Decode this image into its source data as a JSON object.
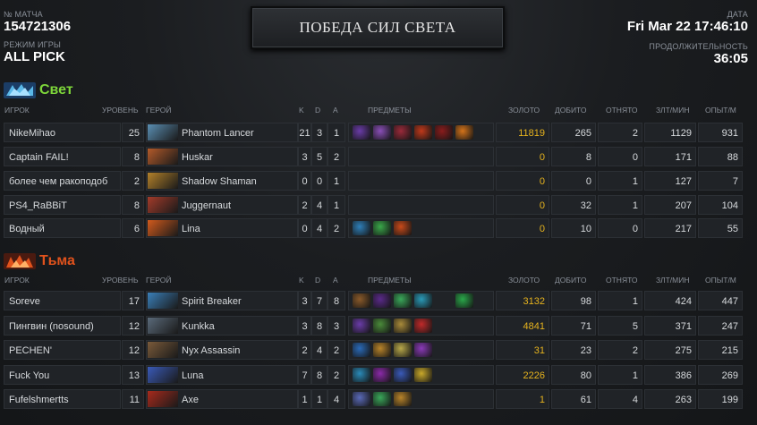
{
  "header": {
    "match_id_label": "№ МАТЧА",
    "match_id": "154721306",
    "game_mode_label": "РЕЖИМ ИГРЫ",
    "game_mode": "ALL PICK",
    "date_label": "ДАТА",
    "date": "Fri Mar 22 17:46:10",
    "duration_label": "ПРОДОЛЖИТЕЛЬНОСТЬ",
    "duration": "36:05",
    "result_banner": "ПОБЕДА СИЛ СВЕТА"
  },
  "columns": {
    "player": "ИГРОК",
    "level": "УРОВЕНЬ",
    "hero": "ГЕРОЙ",
    "k": "K",
    "d": "D",
    "a": "A",
    "items": "ПРЕДМЕТЫ",
    "gold": "ЗОЛОТО",
    "last_hits": "ДОБИТО",
    "denies": "ОТНЯТО",
    "xpm": "ЗЛТ/МИН",
    "gpm": "ОПЫТ/М"
  },
  "teams": [
    {
      "name": "Свет",
      "color": "#7dd63a",
      "icon": "radiant-icon",
      "players": [
        {
          "player": "NikeMihao",
          "level": "25",
          "hero": "Phantom Lancer",
          "hero_color": "#5a8fb3",
          "k": "21",
          "d": "3",
          "a": "1",
          "items": [
            "#6a3ca8",
            "#8a4fb8",
            "#9a2a3a",
            "#c0391b",
            "#8a1c1c",
            "#d4731a"
          ],
          "gold": "11819",
          "last_hits": "265",
          "denies": "2",
          "xpm": "1129",
          "gpm": "931"
        },
        {
          "player": "Captain FAIL!",
          "level": "8",
          "hero": "Huskar",
          "hero_color": "#b35a2a",
          "k": "3",
          "d": "5",
          "a": "2",
          "items": [],
          "gold": "0",
          "last_hits": "8",
          "denies": "0",
          "xpm": "171",
          "gpm": "88"
        },
        {
          "player": "более чем ракоподоб",
          "level": "2",
          "hero": "Shadow Shaman",
          "hero_color": "#b3812a",
          "k": "0",
          "d": "0",
          "a": "1",
          "items": [],
          "gold": "0",
          "last_hits": "0",
          "denies": "1",
          "xpm": "127",
          "gpm": "7"
        },
        {
          "player": "PS4_RaBBiT",
          "level": "8",
          "hero": "Juggernaut",
          "hero_color": "#a33b2a",
          "k": "2",
          "d": "4",
          "a": "1",
          "items": [],
          "gold": "0",
          "last_hits": "32",
          "denies": "1",
          "xpm": "207",
          "gpm": "104"
        },
        {
          "player": "Водный",
          "level": "6",
          "hero": "Lina",
          "hero_color": "#d25a1c",
          "k": "0",
          "d": "4",
          "a": "2",
          "items": [
            "#2f7fb8",
            "#3aa84a",
            "#c84a1a"
          ],
          "gold": "0",
          "last_hits": "10",
          "denies": "0",
          "xpm": "217",
          "gpm": "55"
        }
      ]
    },
    {
      "name": "Тьма",
      "color": "#e0521c",
      "icon": "dire-icon",
      "players": [
        {
          "player": "Soreve",
          "level": "17",
          "hero": "Spirit Breaker",
          "hero_color": "#3a7fb8",
          "k": "3",
          "d": "7",
          "a": "8",
          "items": [
            "#8a5a2a",
            "#5a2a8a",
            "#3aa85a",
            "#2a9ab8",
            "",
            "#2aa84a"
          ],
          "gold": "3132",
          "last_hits": "98",
          "denies": "1",
          "xpm": "424",
          "gpm": "447"
        },
        {
          "player": "Пингвин (nosound)",
          "level": "12",
          "hero": "Kunkka",
          "hero_color": "#5a6a7a",
          "k": "3",
          "d": "8",
          "a": "3",
          "items": [
            "#6a3ca8",
            "#4a8a3a",
            "#a88a3a",
            "#c02a2a"
          ],
          "gold": "4841",
          "last_hits": "71",
          "denies": "5",
          "xpm": "371",
          "gpm": "247"
        },
        {
          "player": "PECHEN'",
          "level": "12",
          "hero": "Nyx Assassin",
          "hero_color": "#7a5a3a",
          "k": "2",
          "d": "4",
          "a": "2",
          "items": [
            "#2a6ab8",
            "#b8842a",
            "#b8a84a",
            "#8a3ab8"
          ],
          "gold": "31",
          "last_hits": "23",
          "denies": "2",
          "xpm": "275",
          "gpm": "215"
        },
        {
          "player": "Fuck You",
          "level": "13",
          "hero": "Luna",
          "hero_color": "#3a5ab8",
          "k": "7",
          "d": "8",
          "a": "2",
          "items": [
            "#2a8ab8",
            "#8a2aa8",
            "#3a5ab8",
            "#c8a82a"
          ],
          "gold": "2226",
          "last_hits": "80",
          "denies": "1",
          "xpm": "386",
          "gpm": "269"
        },
        {
          "player": "Fufelshmertts",
          "level": "11",
          "hero": "Axe",
          "hero_color": "#a82a1c",
          "k": "1",
          "d": "1",
          "a": "4",
          "items": [
            "#5a6ab8",
            "#3aa85a",
            "#b8842a"
          ],
          "gold": "1",
          "last_hits": "61",
          "denies": "4",
          "xpm": "263",
          "gpm": "199"
        }
      ]
    }
  ]
}
